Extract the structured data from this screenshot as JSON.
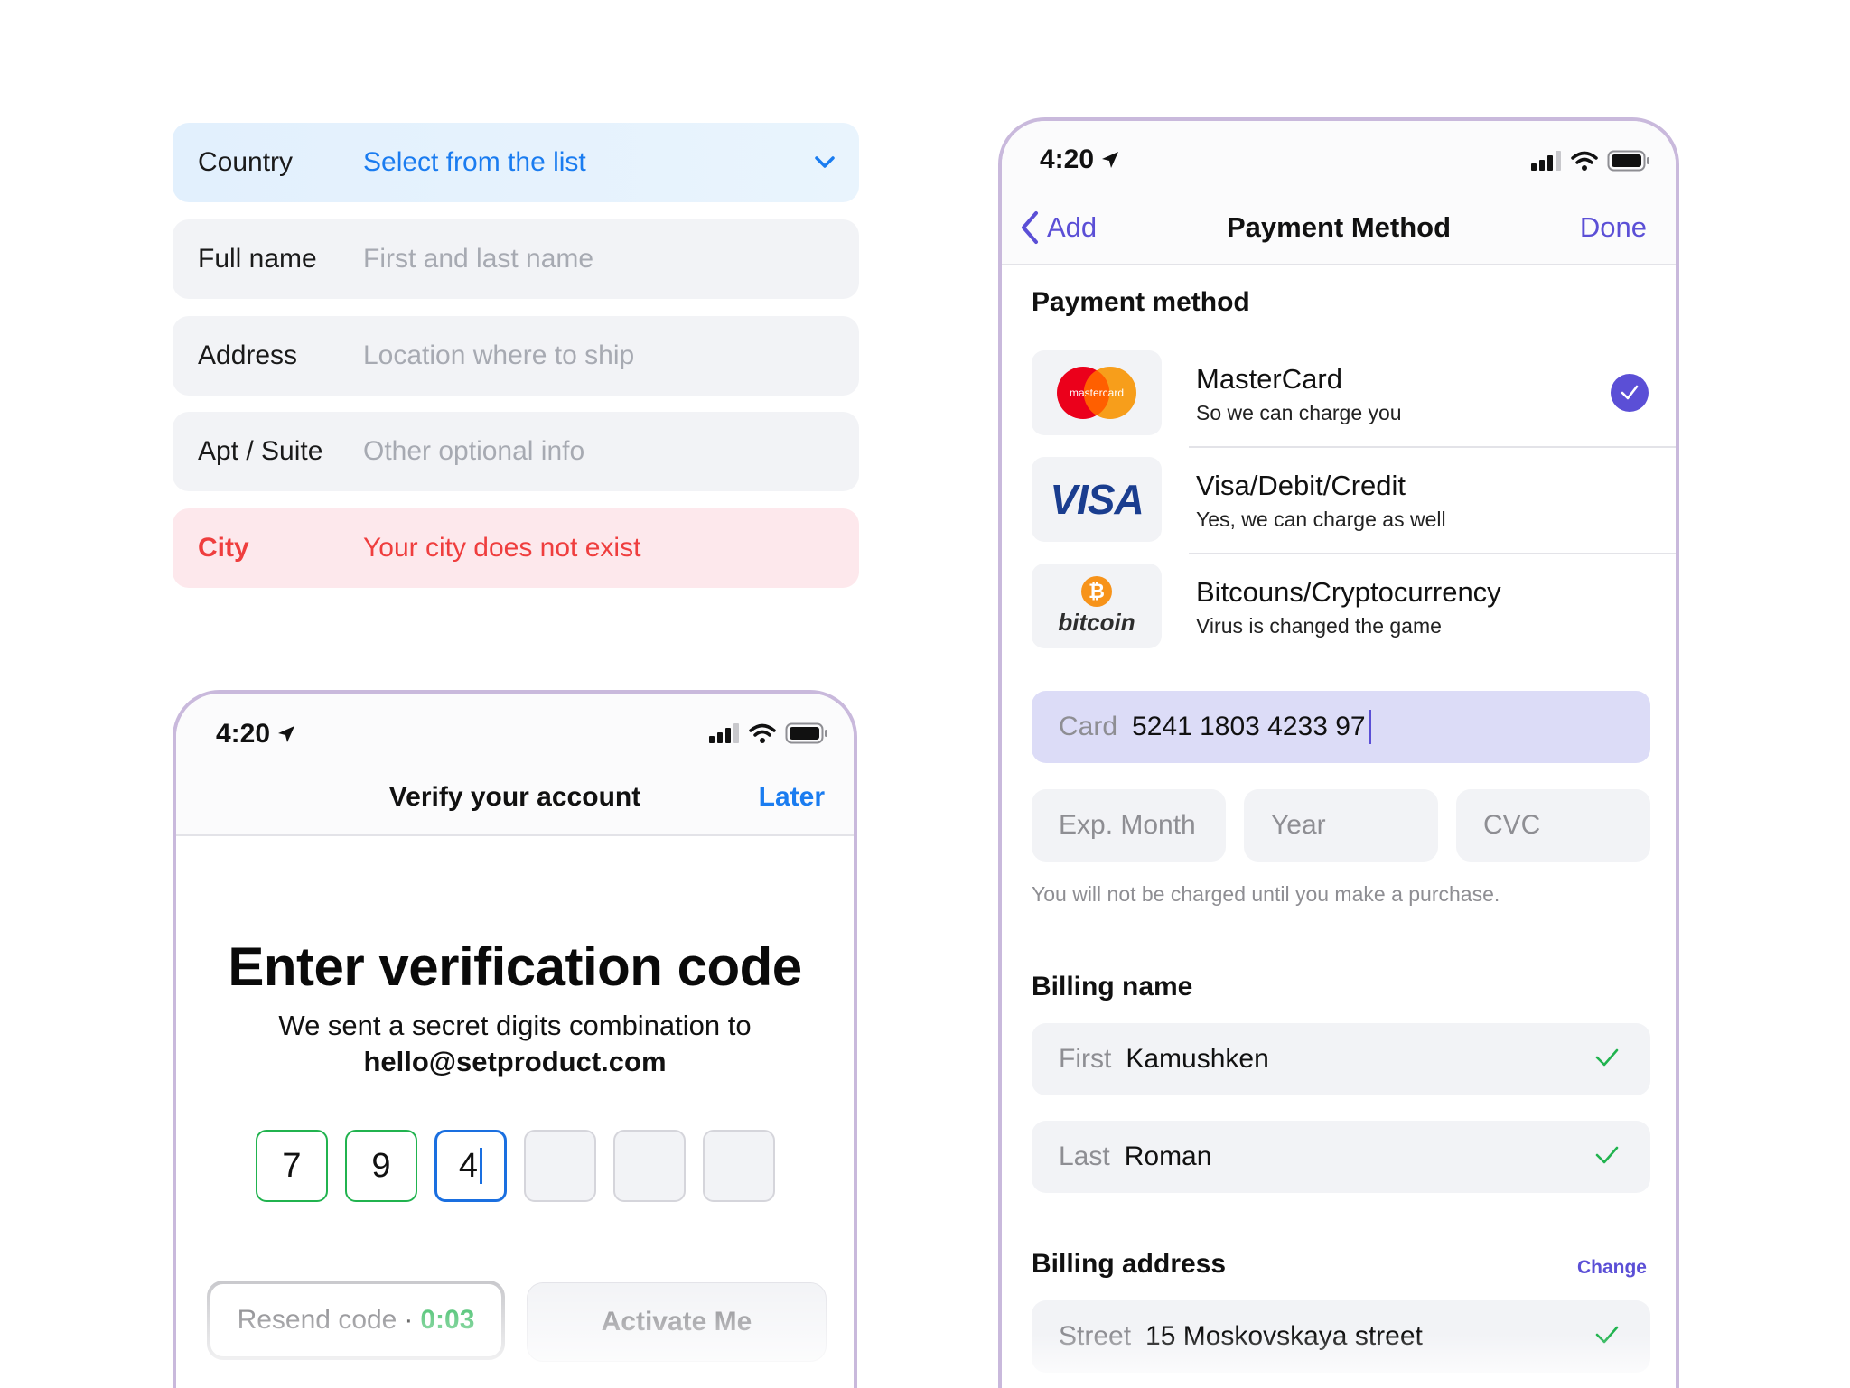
{
  "address_form": {
    "country": {
      "label": "Country",
      "value": "Select from the list"
    },
    "full_name": {
      "label": "Full name",
      "placeholder": "First and last name"
    },
    "address": {
      "label": "Address",
      "placeholder": "Location where to ship"
    },
    "apt": {
      "label": "Apt / Suite",
      "placeholder": "Other optional info"
    },
    "city": {
      "label": "City",
      "error": "Your city does not exist"
    },
    "colors": {
      "accent": "#1a7cf0",
      "error": "#ef3e3e"
    }
  },
  "verify_screen": {
    "status_time": "4:20",
    "nav_title": "Verify your account",
    "nav_action": "Later",
    "heading": "Enter verification code",
    "subtitle": "We sent a secret digits combination to",
    "email": "hello@setproduct.com",
    "code_digits": [
      "7",
      "9",
      "4",
      "",
      "",
      ""
    ],
    "resend_label": "Resend code",
    "resend_separator": "·",
    "resend_timer": "0:03",
    "activate_label": "Activate Me",
    "colors": {
      "success": "#21b34f",
      "focus": "#1a6fe0"
    }
  },
  "payment_screen": {
    "status_time": "4:20",
    "nav_back": "Add",
    "nav_title": "Payment Method",
    "nav_done": "Done",
    "section_payment": "Payment method",
    "methods": [
      {
        "name": "MasterCard",
        "desc": "So we can charge you",
        "logo": "mastercard",
        "logo_text": "mastercard",
        "selected": true
      },
      {
        "name": "Visa/Debit/Credit",
        "desc": "Yes, we can charge as well",
        "logo": "VISA",
        "selected": false
      },
      {
        "name": "Bitcouns/Cryptocurrency",
        "desc": "Virus is changed the game",
        "logo": "bitcoin",
        "selected": false
      }
    ],
    "card": {
      "label": "Card",
      "value": "5241 1803 4233 97"
    },
    "exp_month": "Exp. Month",
    "year": "Year",
    "cvc": "CVC",
    "note": "You will not be charged until you make a purchase.",
    "section_billing_name": "Billing name",
    "first": {
      "label": "First",
      "value": "Kamushken"
    },
    "last": {
      "label": "Last",
      "value": "Roman"
    },
    "section_billing_address": "Billing address",
    "change": "Change",
    "street": {
      "label": "Street",
      "value": "15 Moskovskaya street"
    },
    "colors": {
      "accent": "#5b4fd6",
      "card_field": "#dcdcf7"
    }
  }
}
